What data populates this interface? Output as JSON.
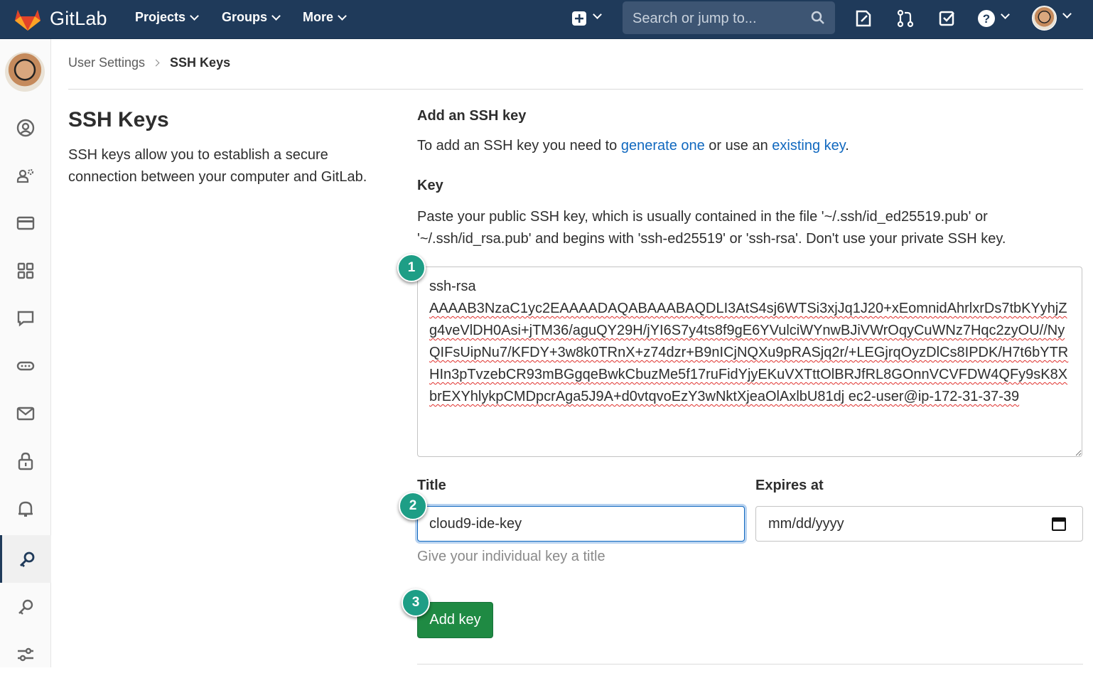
{
  "nav": {
    "logo_text": "GitLab",
    "projects": "Projects",
    "groups": "Groups",
    "more": "More",
    "search_placeholder": "Search or jump to..."
  },
  "breadcrumb": {
    "parent": "User Settings",
    "current": "SSH Keys"
  },
  "left": {
    "title": "SSH Keys",
    "description": "SSH keys allow you to establish a secure connection between your computer and GitLab."
  },
  "form": {
    "heading": "Add an SSH key",
    "intro_pre": "To add an SSH key you need to ",
    "generate_link": "generate one",
    "intro_mid": " or use an ",
    "existing_link": "existing key",
    "intro_post": ".",
    "key_label": "Key",
    "key_help": "Paste your public SSH key, which is usually contained in the file '~/.ssh/id_ed25519.pub' or '~/.ssh/id_rsa.pub' and begins with 'ssh-ed25519' or 'ssh-rsa'. Don't use your private SSH key.",
    "key_prefix": "ssh-rsa",
    "key_body": "AAAAB3NzaC1yc2EAAAADAQABAAABAQDLI3AtS4sj6WTSi3xjJq1J20+xEomnidAhrlxrDs7tbKYyhjZg4veVlDH0Asi+jTM36/aguQY29H/jYI6S7y4ts8f9gE6YVulciWYnwBJiVWrOqyCuWNz7Hqc2zyOU//NyQIFsUipNu7/KFDY+3w8k0TRnX+z74dzr+B9nICjNQXu9pRASjq2r/+LEGjrqOyzDlCs8IPDK/H7t6bYTRHIn3pTvzebCR93mBGgqeBwkCbuzMe5f17ruFidYjyEKuVXTttOlBRJfRL8GOnnVCVFDW4QFy9sK8XbrEXYhlykpCMDpcrAga5J9A+d0vtqvoEzY3wNktXjeaOlAxlbU81dj ec2-user@ip-172-31-37-39",
    "title_label": "Title",
    "title_value": "cloud9-ide-key",
    "expires_label": "Expires at",
    "expires_placeholder": "mm/dd/yyyy",
    "title_help": "Give your individual key a title",
    "submit": "Add key"
  },
  "badges": [
    "1",
    "2",
    "3"
  ],
  "colors": {
    "navbar": "#1f3a5a",
    "link": "#1068bf",
    "submit": "#1f8a43",
    "badge": "#1e9e86"
  }
}
